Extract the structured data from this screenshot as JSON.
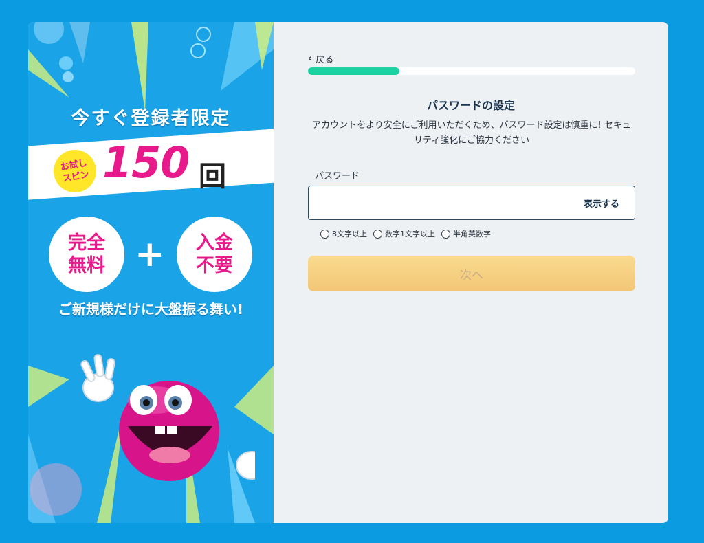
{
  "promo": {
    "headline": "今すぐ登録者限定",
    "trial_badge_line1": "お試し",
    "trial_badge_line2": "スピン",
    "spin_count": "150",
    "spin_unit": "回",
    "badge_left_line1": "完全",
    "badge_left_line2": "無料",
    "plus": "+",
    "badge_right_line1": "入金",
    "badge_right_line2": "不要",
    "tagline": "ご新規様だけに大盤振る舞い!",
    "colors": {
      "background": "#1aa3e6",
      "accent": "#e8198b",
      "badge": "#ffe629"
    }
  },
  "form": {
    "back_label": "戻る",
    "back_icon": "chevron-left-icon",
    "progress_percent": 28,
    "title": "パスワードの設定",
    "description": "アカウントをより安全にご利用いただくため、パスワード設定は慎重に! セキュリティ強化にご協力ください",
    "password_label": "パスワード",
    "password_value": "",
    "show_label": "表示する",
    "rules": [
      "8文字以上",
      "数字1文字以上",
      "半角英数字"
    ],
    "next_label": "次へ",
    "colors": {
      "progress": "#1dd3a1",
      "button": "#f6d184",
      "page_bg": "#0a9be0"
    }
  }
}
